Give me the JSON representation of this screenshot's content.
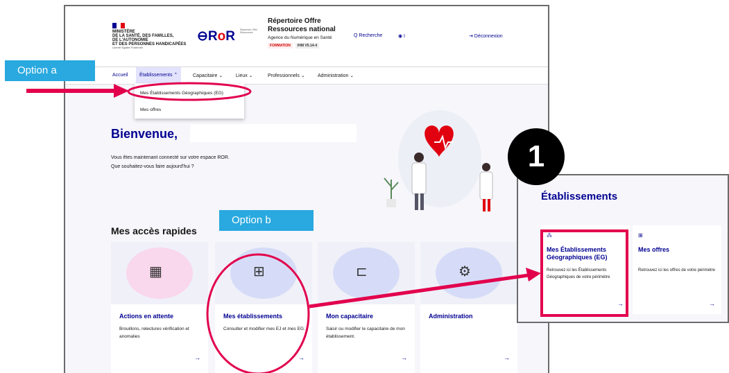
{
  "header": {
    "ministry_lines": [
      "MINISTÈRE",
      "DE LA SANTÉ, DES FAMILLES,",
      "DE L'AUTONOMIE",
      "ET DES PERSONNES HANDICAPÉES"
    ],
    "ministry_motto": "Liberté Égalité Fraternité",
    "logo_text_a": "R",
    "logo_text_o": "o",
    "logo_text_b": "R",
    "logo_tagline": "Répertoire Offre Ressources",
    "app_title": "Répertoire Offre Ressources national",
    "app_subtitle": "Agence du Numérique en Santé",
    "badge_env": "FORMATION",
    "badge_version": "IHM V5.14-4",
    "search_label": "Q  Recherche",
    "user_label": "◉ I",
    "logout_label": "⇥  Déconnexion"
  },
  "nav": {
    "items": [
      "Accueil",
      "Établissements ⌃",
      "Capacitaire ⌄",
      "Lieux ⌄",
      "Professionnels ⌄",
      "Administration ⌄"
    ]
  },
  "dropdown": {
    "items": [
      "Mes Établissements Géographiques (EG)",
      "Mes offres"
    ]
  },
  "main": {
    "welcome": "Bienvenue,",
    "intro_line1": "Vous êtes maintenant connecté sur votre espace ROR.",
    "intro_line2": "Que souhaitez-vous faire aujourd'hui ?",
    "quick_access_title": "Mes accès rapides"
  },
  "cards": [
    {
      "title": "Actions en attente",
      "desc": "Brouillons, relectures vérification et anomalies",
      "icon": "▦",
      "blob_color": "#f9d7ec",
      "arrow": "→"
    },
    {
      "title": "Mes établissements",
      "desc": "Consulter et modifier mes EJ et mes EG.",
      "icon": "⊞",
      "blob_color": "#d6dcf7",
      "arrow": "→"
    },
    {
      "title": "Mon capacitaire",
      "desc": "Saisir ou modifier le capacitaire de mon établissement.",
      "icon": "⊏",
      "blob_color": "#d6dcf7",
      "arrow": "→"
    },
    {
      "title": "Administration",
      "desc": "",
      "icon": "⚙",
      "blob_color": "#d6dcf7",
      "arrow": "→"
    }
  ],
  "annotations": {
    "option_a": "Option a",
    "option_b": "Option b",
    "step_number": "1",
    "highlight_color": "#e2004d",
    "callout_color": "#29a9df"
  },
  "zoom_panel": {
    "title": "Établissements",
    "cards": [
      {
        "icon": "⁂",
        "title": "Mes Établissements Géographiques (EG)",
        "desc": "Retrouvez ici les Établissements Géographiques de votre périmètre",
        "arrow": "→"
      },
      {
        "icon": "⊞",
        "title": "Mes offres",
        "desc": "Retrouvez ici les offres de votre périmètre",
        "arrow": "→"
      }
    ]
  }
}
